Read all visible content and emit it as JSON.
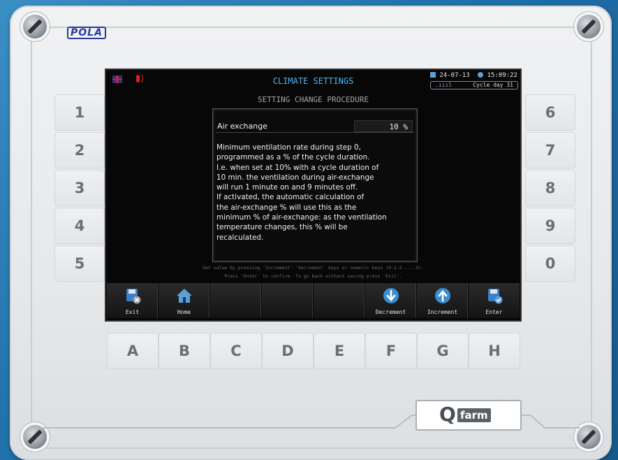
{
  "brand": "POLA",
  "screen": {
    "title": "CLIMATE SETTINGS",
    "date": "24-07-13",
    "time": "15:09:22",
    "cycle_day": "Cycle day 31",
    "subtitle": "SETTING CHANGE PROCEDURE"
  },
  "dialog": {
    "parameter": "Air exchange",
    "value": "10 %",
    "description": "Minimum ventilation rate during step 0,\nprogrammed as a % of the cycle duration.\nI.e. when set at 10% with a cycle duration of\n10 min. the ventilation during air-exchange\nwill run 1 minute on and 9 minutes off.\nIf activated, the automatic calculation of\nthe air-exchange % will use this as the\nminimum % of air-exchange: as the ventilation\ntemperature changes, this % will be\nrecalculated."
  },
  "hints": {
    "line1": "Set value by pressing 'Increment' 'Decrement' keys or numeric keys (0-1-2.....9).",
    "line2": "Press 'Enter' to confirm. To go back without saving press 'Exit'."
  },
  "function_keys": [
    "Exit",
    "Home",
    "",
    "",
    "",
    "Decrement",
    "Increment",
    "Enter"
  ],
  "numeric_keys_left": [
    "1",
    "2",
    "3",
    "4",
    "5"
  ],
  "numeric_keys_right": [
    "6",
    "7",
    "8",
    "9",
    "0"
  ],
  "letter_keys": [
    "A",
    "B",
    "C",
    "D",
    "E",
    "F",
    "G",
    "H"
  ],
  "logo": {
    "q": "Q",
    "farm": "farm"
  },
  "colors": {
    "title": "#4fb4f0",
    "icon_blue": "#3a8fd4",
    "background": "#1f6fa8"
  }
}
